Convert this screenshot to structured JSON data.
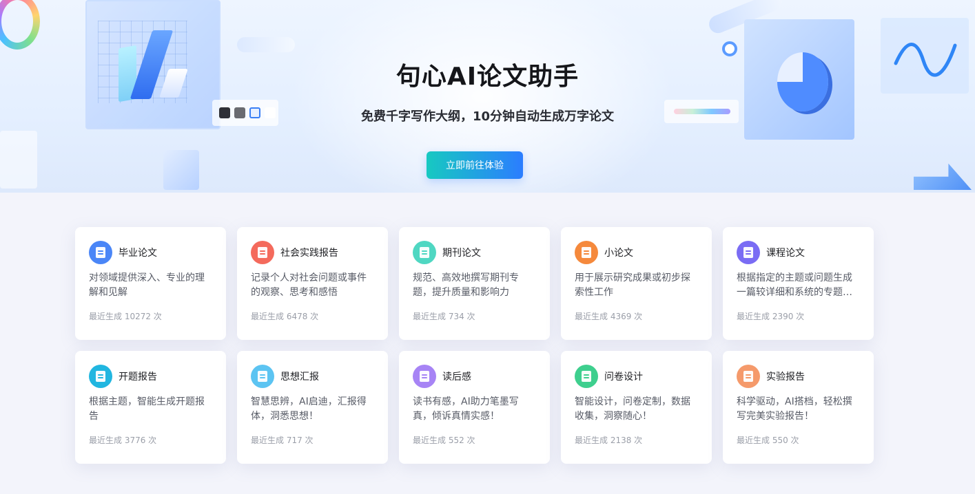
{
  "hero": {
    "title": "句心AI论文助手",
    "subtitle": "免费千字写作大纲，10分钟自动生成万字论文",
    "cta_label": "立即前往体验"
  },
  "colors": {
    "cta_gradient_start": "#17c9c1",
    "cta_gradient_end": "#2b7dff",
    "page_bg": "#f3f4fb"
  },
  "cards": [
    {
      "title": "毕业论文",
      "desc": "对领域提供深入、专业的理解和见解",
      "count": "最近生成 10272 次",
      "icon": "document-icon",
      "color": "#4a86f7"
    },
    {
      "title": "社会实践报告",
      "desc": "记录个人对社会问题或事件的观察、思考和感悟",
      "count": "最近生成 6478 次",
      "icon": "calendar-icon",
      "color": "#f46a5c"
    },
    {
      "title": "期刊论文",
      "desc": "规范、高效地撰写期刊专题，提升质量和影响力",
      "count": "最近生成 734 次",
      "icon": "journal-icon",
      "color": "#4fd7c2"
    },
    {
      "title": "小论文",
      "desc": "用于展示研究成果或初步探索性工作",
      "count": "最近生成 4369 次",
      "icon": "note-icon",
      "color": "#f5893c"
    },
    {
      "title": "课程论文",
      "desc": "根据指定的主题或问题生成一篇较详细和系统的专题研究论文",
      "count": "最近生成 2390 次",
      "icon": "course-icon",
      "color": "#7a6cf4"
    },
    {
      "title": "开题报告",
      "desc": "根据主题，智能生成开题报告",
      "count": "最近生成 3776 次",
      "icon": "book-icon",
      "color": "#21b6e0"
    },
    {
      "title": "思想汇报",
      "desc": "智慧思辨，AI启迪，汇报得体，洞悉思想！",
      "count": "最近生成 717 次",
      "icon": "report-icon",
      "color": "#5cc4f2"
    },
    {
      "title": "读后感",
      "desc": "读书有感，AI助力笔墨写真，倾诉真情实感！",
      "count": "最近生成 552 次",
      "icon": "reading-icon",
      "color": "#a784f5"
    },
    {
      "title": "问卷设计",
      "desc": "智能设计，问卷定制，数据收集，洞察随心！",
      "count": "最近生成 2138 次",
      "icon": "survey-icon",
      "color": "#3ecf8e"
    },
    {
      "title": "实验报告",
      "desc": "科学驱动，AI搭档，轻松撰写完美实验报告！",
      "count": "最近生成 550 次",
      "icon": "flask-icon",
      "color": "#f59a6b"
    }
  ]
}
